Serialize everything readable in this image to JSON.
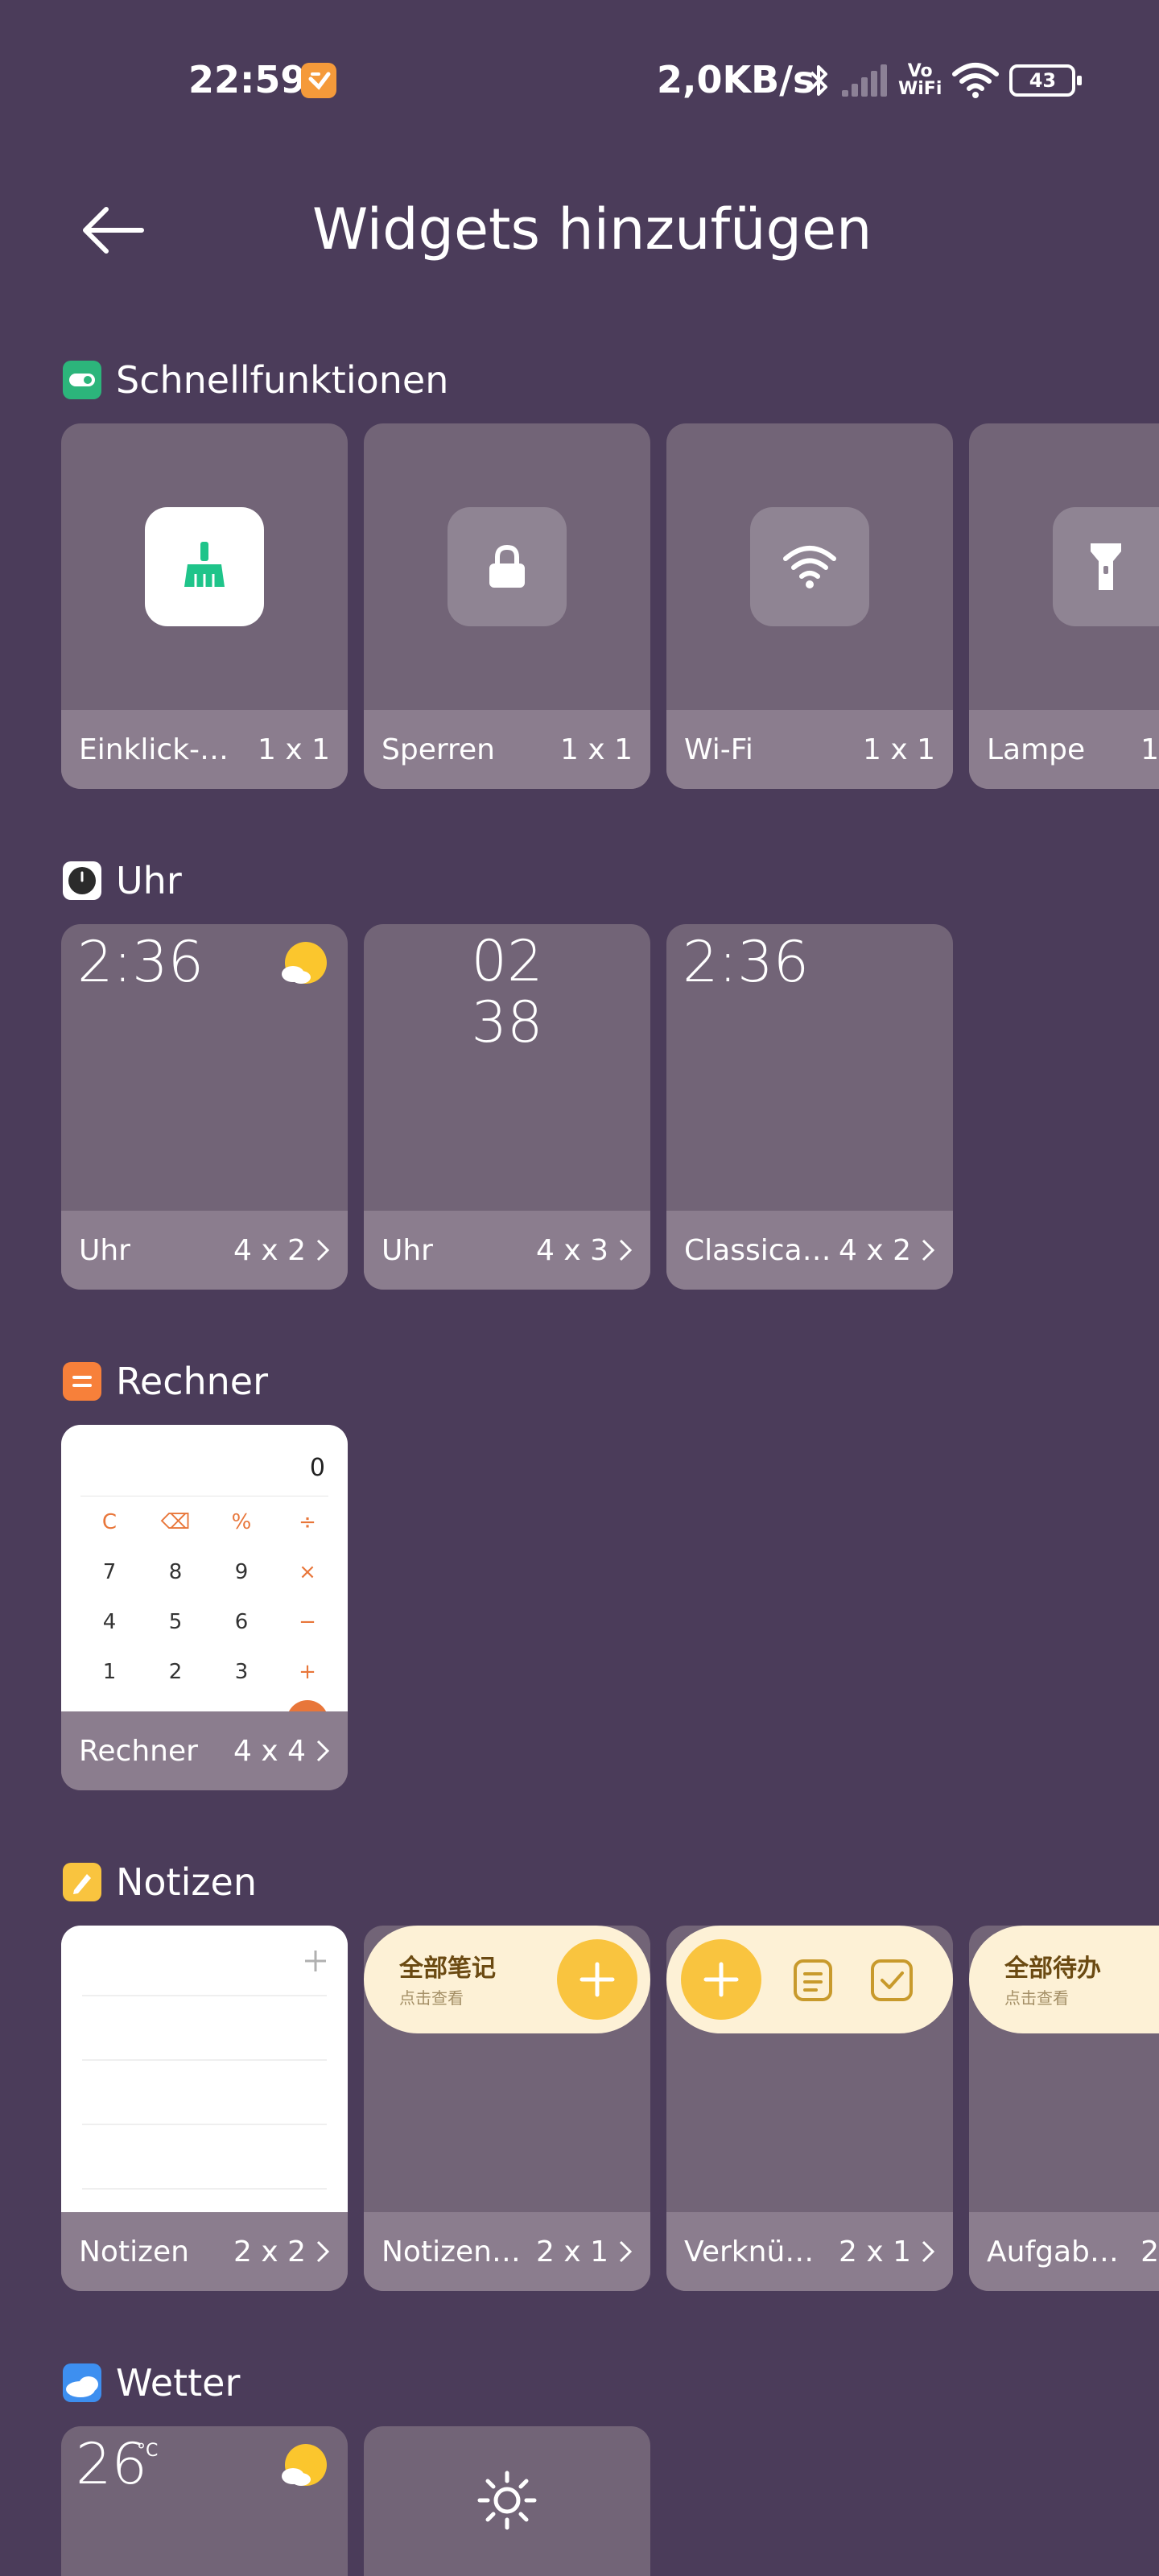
{
  "status_bar": {
    "time": "22:59",
    "speed": "2,0KB/s",
    "vowifi_top": "Vo",
    "vowifi_bottom": "WiFi",
    "battery": "43"
  },
  "header": {
    "title": "Widgets hinzufügen"
  },
  "sections": {
    "quick": {
      "title": "Schnellfunktionen",
      "cards": [
        {
          "name": "Einklick-…",
          "size": "1 x 1"
        },
        {
          "name": "Sperren",
          "size": "1 x 1"
        },
        {
          "name": "Wi-Fi",
          "size": "1 x 1"
        },
        {
          "name": "Lampe",
          "size": "1"
        }
      ]
    },
    "clock": {
      "title": "Uhr",
      "cards": [
        {
          "name": "Uhr",
          "size": "4 x 2",
          "preview": "2:36"
        },
        {
          "name": "Uhr",
          "size": "4 x 3",
          "preview_top": "02",
          "preview_bottom": "38"
        },
        {
          "name": "Classical…",
          "size": "4 x 2",
          "preview": "2:36"
        }
      ]
    },
    "calculator": {
      "title": "Rechner",
      "card": {
        "name": "Rechner",
        "size": "4 x 4"
      },
      "display": "0",
      "keys": [
        [
          "C",
          "⌫",
          "%",
          "÷"
        ],
        [
          "7",
          "8",
          "9",
          "×"
        ],
        [
          "4",
          "5",
          "6",
          "−"
        ],
        [
          "1",
          "2",
          "3",
          "+"
        ]
      ]
    },
    "notes": {
      "title": "Notizen",
      "cards": [
        {
          "name": "Notizen",
          "size": "2 x 2"
        },
        {
          "name": "Notizen…",
          "size": "2 x 1",
          "pill_title": "全部笔记",
          "pill_sub": "点击查看"
        },
        {
          "name": "Verknüpf…",
          "size": "2 x 1"
        },
        {
          "name": "Aufgabe…",
          "size": "2",
          "pill_title": "全部待办",
          "pill_sub": "点击查看"
        }
      ]
    },
    "weather": {
      "title": "Wetter",
      "temp": "26",
      "unit": "°C"
    }
  },
  "colors": {
    "background": "#4b3c5a",
    "card": "#726477",
    "card_footer": "#8b7d8e",
    "accent_yellow": "#f9c43f",
    "cleaner_green": "#1fc48a"
  }
}
